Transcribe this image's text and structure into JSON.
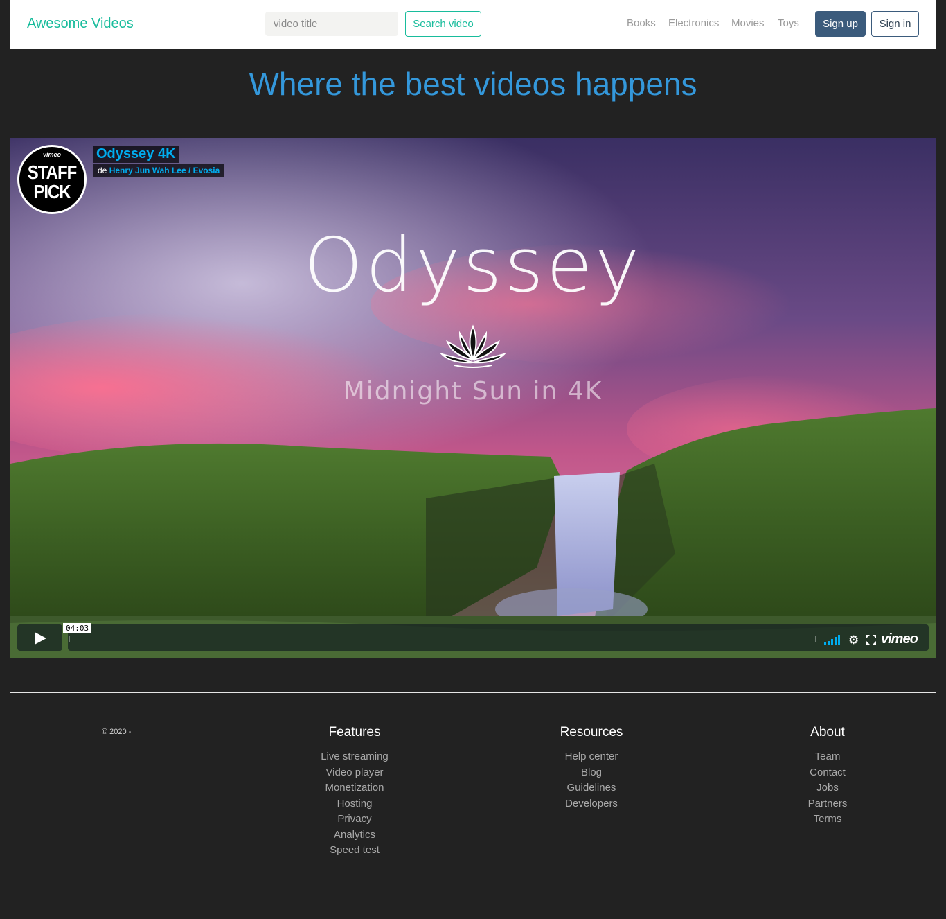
{
  "navbar": {
    "brand": "Awesome Videos",
    "search_placeholder": "video title",
    "search_button": "Search video",
    "links": [
      "Books",
      "Electronics",
      "Movies",
      "Toys"
    ],
    "signup": "Sign up",
    "signin": "Sign in"
  },
  "hero": {
    "title": "Where the best videos happens"
  },
  "video": {
    "title": "Odyssey 4K",
    "byline_prefix": "de",
    "author": "Henry Jun Wah Lee / Evosia",
    "badge_brand": "vimeo",
    "badge_line1": "STAFF",
    "badge_line2": "PICK",
    "overlay_title": "Odyssey",
    "overlay_subtitle": "Midnight Sun in 4K",
    "timecode": "04:03",
    "player_brand": "vimeo",
    "progress": 0
  },
  "footer": {
    "copyright": "© 2020 -",
    "columns": [
      {
        "heading": "Features",
        "items": [
          "Live streaming",
          "Video player",
          "Monetization",
          "Hosting",
          "Privacy",
          "Analytics",
          "Speed test"
        ]
      },
      {
        "heading": "Resources",
        "items": [
          "Help center",
          "Blog",
          "Guidelines",
          "Developers"
        ]
      },
      {
        "heading": "About",
        "items": [
          "Team",
          "Contact",
          "Jobs",
          "Partners",
          "Terms"
        ]
      }
    ]
  },
  "colors": {
    "brand": "#18bc9c",
    "primary": "#3b5b7c",
    "hero": "#3498db",
    "background": "#222222",
    "vimeo_blue": "#00adef"
  }
}
